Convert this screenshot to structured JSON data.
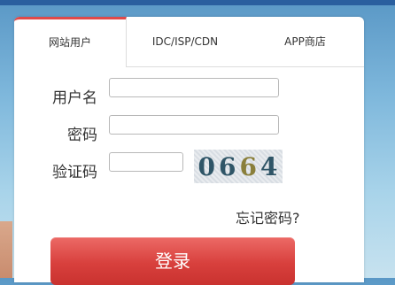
{
  "tabs": [
    {
      "label": "网站用户",
      "active": true
    },
    {
      "label": "IDC/ISP/CDN",
      "active": false
    },
    {
      "label": "APP商店",
      "active": false
    }
  ],
  "form": {
    "username_label": "用户名",
    "username_value": "",
    "password_label": "密码",
    "password_value": "",
    "captcha_label": "验证码",
    "captcha_value": "",
    "captcha_digits": [
      "0",
      "6",
      "6",
      "4"
    ]
  },
  "forgot_link": "忘记密码?",
  "login_button": "登录",
  "colors": {
    "accent": "#e04a4a",
    "button": "#d8403d",
    "background_top": "#5a98c6"
  }
}
